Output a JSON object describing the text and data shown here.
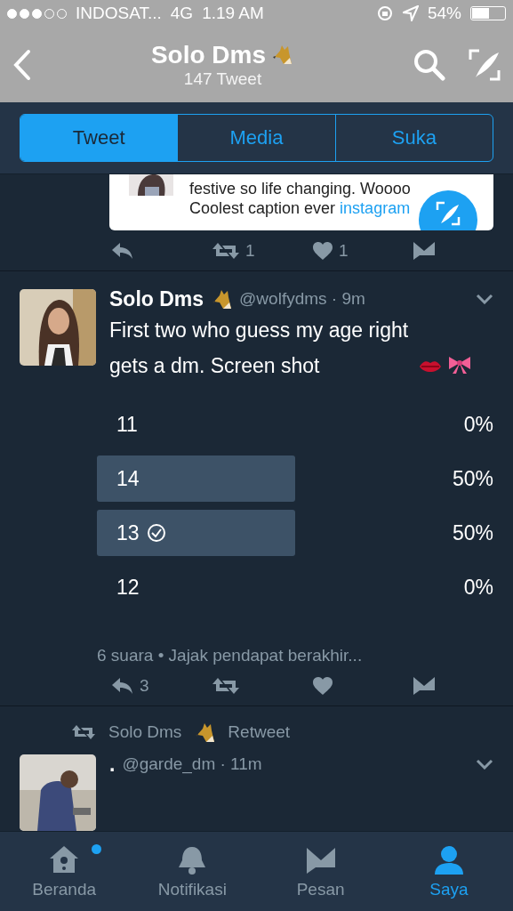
{
  "status_bar": {
    "carrier": "INDOSAT...",
    "network": "4G",
    "time": "1.19 AM",
    "battery": "54%"
  },
  "header": {
    "title": "Solo Dms",
    "subtitle": "147 Tweet"
  },
  "tabs": [
    {
      "label": "Tweet",
      "selected": true
    },
    {
      "label": "Media",
      "selected": false
    },
    {
      "label": "Suka",
      "selected": false
    }
  ],
  "timeline": [
    {
      "kind": "quote_tail",
      "lines": [
        {
          "text": "festive so life changing. Woooo"
        },
        {
          "text": "Coolest caption ever",
          "link": "instagram"
        }
      ],
      "retweets": "1",
      "likes": "1"
    },
    {
      "kind": "poll_tweet",
      "name": "Solo Dms",
      "handle": "@wolfydms · 9m",
      "text": "First two who guess my age right gets a dm. Screen shot",
      "options": [
        {
          "label": "11",
          "percent": "0%",
          "selected": false
        },
        {
          "label": "14",
          "percent": "50%",
          "selected": false
        },
        {
          "label": "13",
          "percent": "50%",
          "selected": true
        },
        {
          "label": "12",
          "percent": "0%",
          "selected": false
        }
      ],
      "footer": "6 suara • Jajak pendapat berakhir...",
      "replies": "3"
    },
    {
      "kind": "retweet",
      "retweeter": "Solo Dms",
      "retweet_label": "Retweet",
      "name": ".",
      "handle": "@garde_dm · 11m"
    }
  ],
  "nav": [
    {
      "label": "Beranda",
      "selected": false,
      "badge": true
    },
    {
      "label": "Notifikasi",
      "selected": false,
      "badge": false
    },
    {
      "label": "Pesan",
      "selected": false,
      "badge": false
    },
    {
      "label": "Saya",
      "selected": true,
      "badge": false
    }
  ]
}
